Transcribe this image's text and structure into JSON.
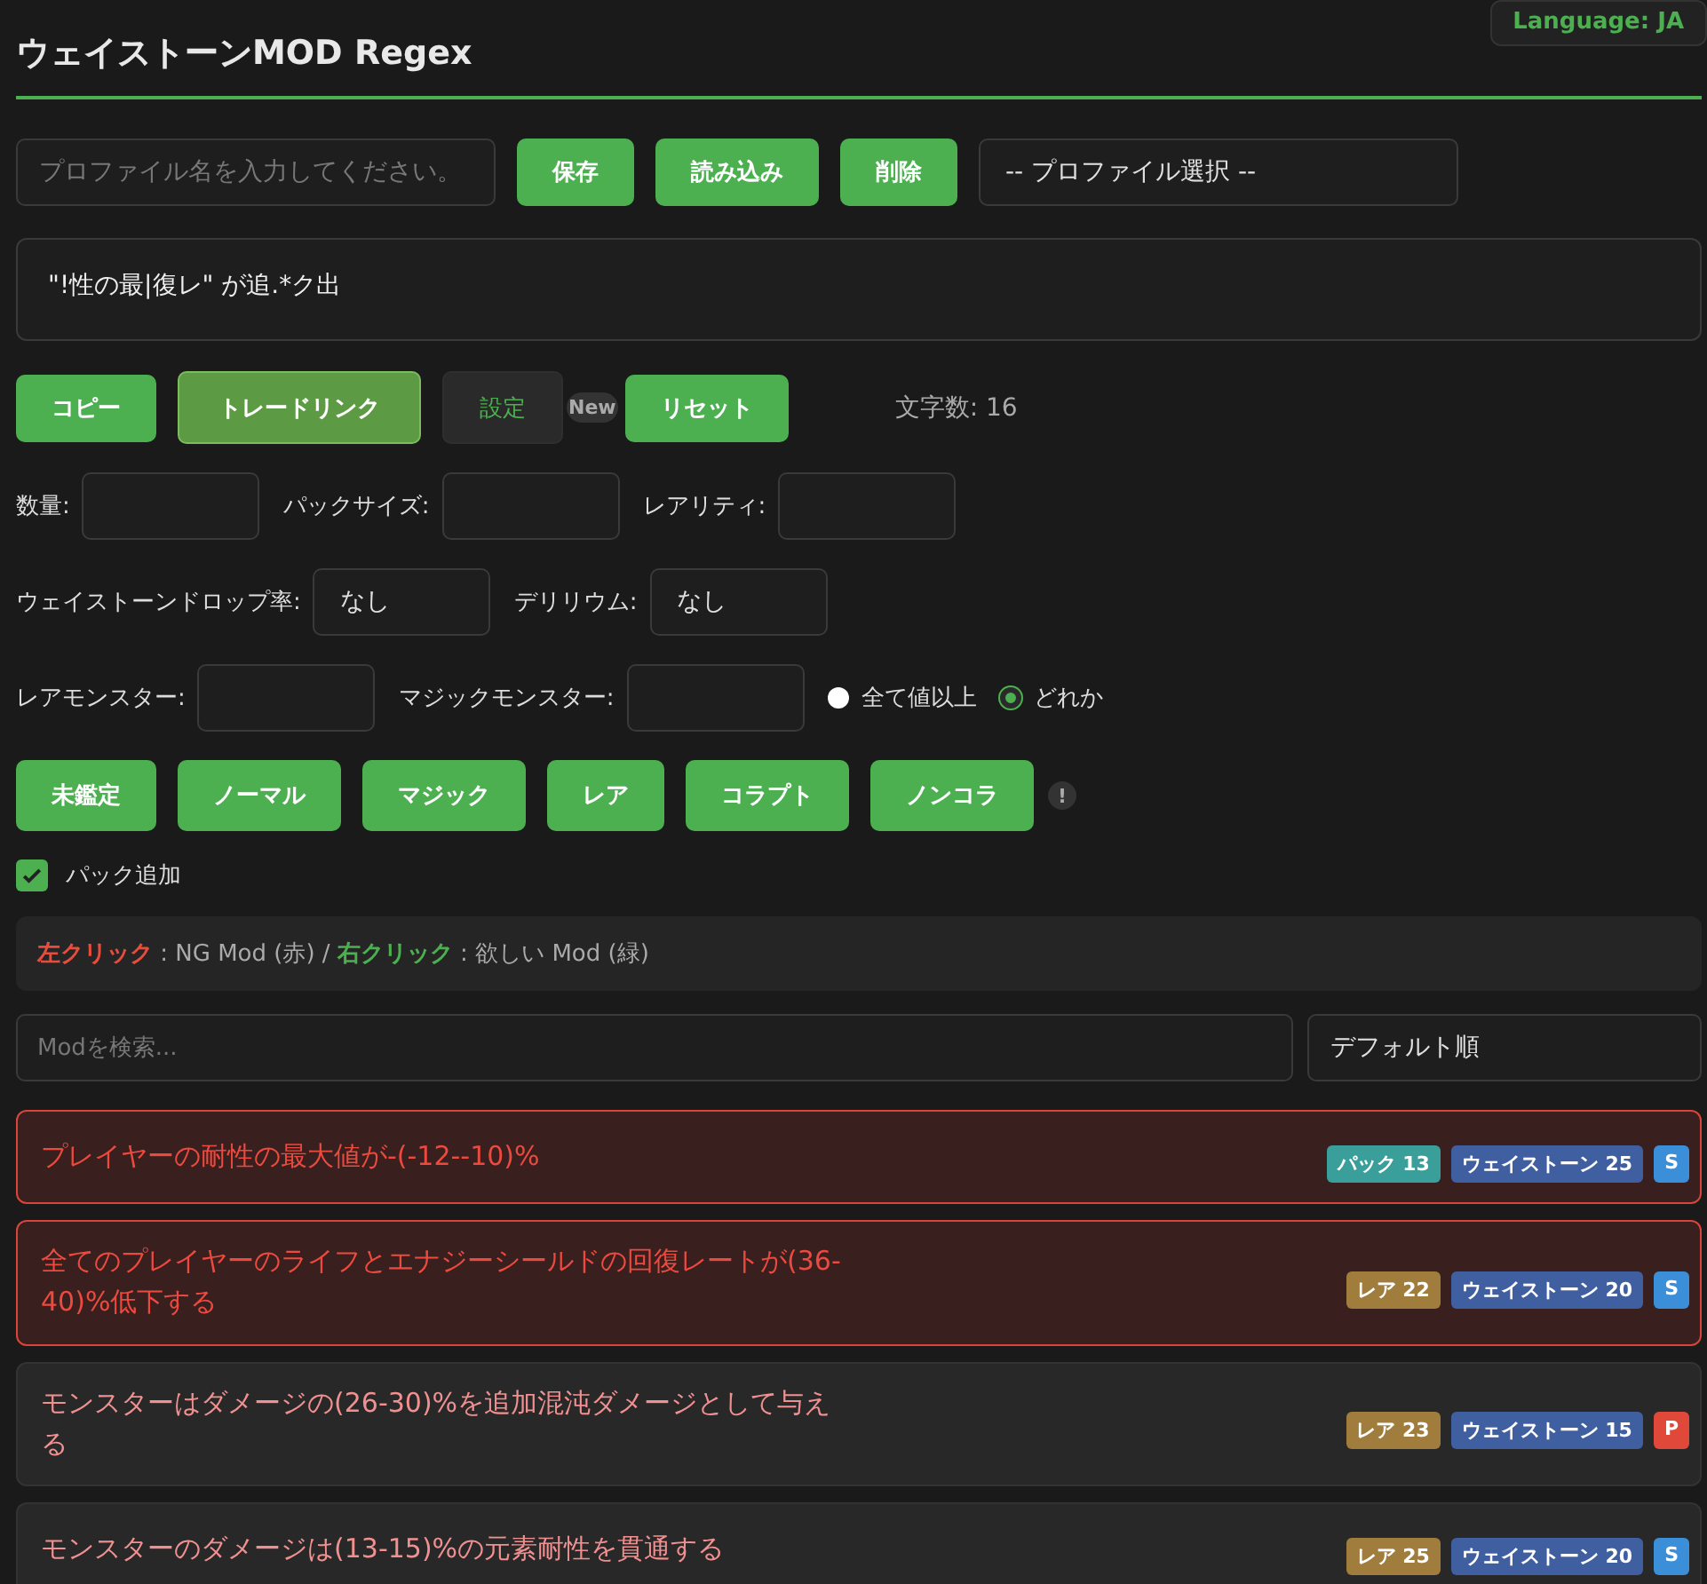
{
  "language_badge": "Language: JA",
  "title": "ウェイストーンMOD Regex",
  "profile": {
    "placeholder": "プロファイル名を入力してください。",
    "buttons": [
      "保存",
      "読み込み",
      "削除"
    ],
    "select": "-- プロファイル選択 --"
  },
  "regex_output": "\"!性の最|復レ\" が追.*ク出",
  "actions": [
    {
      "label": "コピー",
      "kind": "primary"
    },
    {
      "label": "トレードリンク",
      "kind": "accent"
    },
    {
      "label": "設定",
      "kind": "dark",
      "badge": "New"
    },
    {
      "label": "リセット",
      "kind": "primary"
    }
  ],
  "char_count": "文字数: 16",
  "field_rows": [
    [
      {
        "label": "数量:"
      },
      {
        "label": "パックサイズ:"
      },
      {
        "label": "レアリティ:"
      }
    ],
    [
      {
        "label": "ウェイストーンドロップ率:",
        "value": "なし"
      },
      {
        "label": "デリリウム:",
        "value": "なし"
      }
    ],
    [
      {
        "label": "レアモンスター:"
      },
      {
        "label": "マジックモンスター:"
      }
    ]
  ],
  "match_mode": [
    {
      "label": "全て値以上",
      "selected": false
    },
    {
      "label": "どれか",
      "selected": true
    }
  ],
  "rarity_buttons": [
    "未鑑定",
    "ノーマル",
    "マジック",
    "レア",
    "コラプト",
    "ノンコラ"
  ],
  "info_mark": "!",
  "pack_add": {
    "label": "パック追加",
    "checked": true
  },
  "hint": "**左クリック** : NG Mod (赤) / *右クリック* : 欲しい Mod (緑)",
  "search": {
    "placeholder": "Modを検索..."
  },
  "sort": "デフォルト順",
  "mods": [
    {
      "text": "プレイヤーの耐性の最大値が-(-12--10)%",
      "ng": true,
      "tags": [
        {
          "label": "パック 13",
          "color": "#3a9e9a"
        },
        {
          "label": "ウェイストーン 25",
          "color": "#3f5fa0"
        },
        {
          "label": "S",
          "color": "#3a8fd8"
        }
      ]
    },
    {
      "text": "全てのプレイヤーのライフとエナジーシールドの回復レートが(36-40)%低下する",
      "ng": true,
      "tags": [
        {
          "label": "レア 22",
          "color": "#a07d3c"
        },
        {
          "label": "ウェイストーン 20",
          "color": "#3f5fa0"
        },
        {
          "label": "S",
          "color": "#3a8fd8"
        }
      ]
    },
    {
      "text": "モンスターはダメージの(26-30)%を追加混沌ダメージとして与える",
      "ng": false,
      "tags": [
        {
          "label": "レア 23",
          "color": "#a07d3c"
        },
        {
          "label": "ウェイストーン 15",
          "color": "#3f5fa0"
        },
        {
          "label": "P",
          "color": "#e0483a"
        }
      ]
    },
    {
      "text": "モンスターのダメージは(13-15)%の元素耐性を貫通する",
      "ng": false,
      "tags": [
        {
          "label": "レア 25",
          "color": "#a07d3c"
        },
        {
          "label": "ウェイストーン 20",
          "color": "#3f5fa0"
        },
        {
          "label": "S",
          "color": "#3a8fd8"
        }
      ]
    }
  ]
}
